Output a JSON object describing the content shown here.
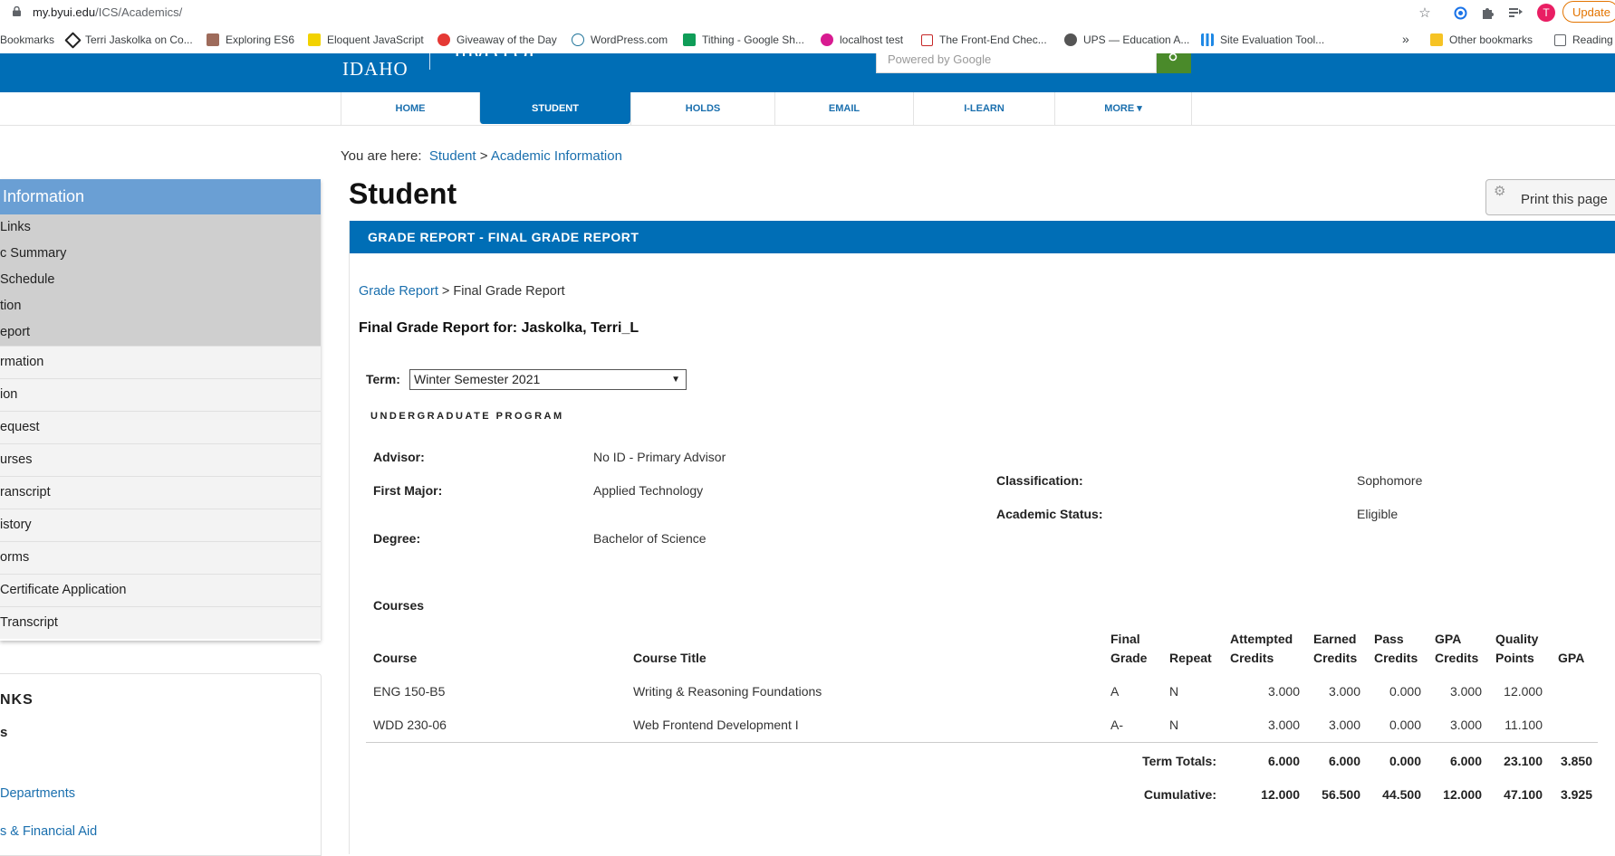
{
  "browser": {
    "url_host": "my.byui.edu",
    "url_path": "/ICS/Academics/",
    "profile_initial": "T",
    "update_label": "Update"
  },
  "bookmarks": {
    "items": [
      {
        "label": "Bookmarks",
        "icon": "none"
      },
      {
        "label": "Terri Jaskolka on Co...",
        "icon": "codepen-icon"
      },
      {
        "label": "Exploring ES6",
        "icon": "book-icon"
      },
      {
        "label": "Eloquent JavaScript",
        "icon": "ejs-icon"
      },
      {
        "label": "Giveaway of the Day",
        "icon": "gift-icon"
      },
      {
        "label": "WordPress.com",
        "icon": "wordpress-icon"
      },
      {
        "label": "Tithing - Google Sh...",
        "icon": "sheets-icon"
      },
      {
        "label": "localhost test",
        "icon": "localhost-icon"
      },
      {
        "label": "The Front-End Chec...",
        "icon": "checklist-icon"
      },
      {
        "label": "UPS — Education A...",
        "icon": "globe-icon"
      },
      {
        "label": "Site Evaluation Tool...",
        "icon": "chart-icon"
      }
    ],
    "overflow": "»",
    "other": "Other bookmarks",
    "reading": "Reading"
  },
  "header": {
    "idaho": "IDAHO",
    "brand": "myBYUI",
    "search_placeholder": "Powered by Google"
  },
  "nav": {
    "items": [
      "HOME",
      "STUDENT",
      "HOLDS",
      "EMAIL",
      "I-LEARN",
      "MORE ▾"
    ],
    "active": "STUDENT"
  },
  "breadcrumb": {
    "prefix": "You are here:",
    "crumb1": "Student",
    "sep": ">",
    "crumb2": "Academic Information"
  },
  "sidebar": {
    "heading": "Information",
    "sub_items": [
      "Links",
      "c Summary",
      "Schedule",
      "tion",
      "eport"
    ],
    "items": [
      "rmation",
      "ion",
      "equest",
      "urses",
      "ranscript",
      "istory",
      "orms",
      "Certificate Application",
      "Transcript"
    ]
  },
  "links_box": {
    "title": "NKS",
    "s": "s",
    "links": [
      "Departments",
      "s & Financial Aid"
    ]
  },
  "main": {
    "title": "Student",
    "print_label": "Print this page",
    "panel_title": "GRADE REPORT - FINAL GRADE REPORT",
    "sub_crumb_link": "Grade Report",
    "sub_crumb_sep": ">",
    "sub_crumb_current": "Final Grade Report",
    "report_for": "Final Grade Report for: Jaskolka, Terri_L",
    "term_label": "Term:",
    "term_value": "Winter Semester 2021",
    "program": "UNDERGRADUATE PROGRAM",
    "info": {
      "advisor_label": "Advisor:",
      "advisor": "No ID - Primary Advisor",
      "major_label": "First Major:",
      "major": "Applied Technology",
      "degree_label": "Degree:",
      "degree": "Bachelor of Science",
      "class_label": "Classification:",
      "classification": "Sophomore",
      "status_label": "Academic Status:",
      "status": "Eligible"
    },
    "courses_label": "Courses"
  },
  "table": {
    "headers": {
      "course": "Course",
      "title": "Course Title",
      "final_grade_1": "Final",
      "final_grade_2": "Grade",
      "repeat": "Repeat",
      "attempted_1": "Attempted",
      "attempted_2": "Credits",
      "earned_1": "Earned",
      "earned_2": "Credits",
      "pass_1": "Pass",
      "pass_2": "Credits",
      "gpa_credits_1": "GPA",
      "gpa_credits_2": "Credits",
      "quality_1": "Quality",
      "quality_2": "Points",
      "gpa": "GPA"
    },
    "rows": [
      {
        "course": "ENG 150-B5",
        "title": "Writing & Reasoning Foundations",
        "grade": "A",
        "repeat": "N",
        "attempted": "3.000",
        "earned": "3.000",
        "pass": "0.000",
        "gpa_credits": "3.000",
        "quality": "12.000"
      },
      {
        "course": "WDD 230-06",
        "title": "Web Frontend Development I",
        "grade": "A-",
        "repeat": "N",
        "attempted": "3.000",
        "earned": "3.000",
        "pass": "0.000",
        "gpa_credits": "3.000",
        "quality": "11.100"
      }
    ],
    "term_totals": {
      "label": "Term Totals:",
      "attempted": "6.000",
      "earned": "6.000",
      "pass": "0.000",
      "gpa_credits": "6.000",
      "quality": "23.100",
      "gpa": "3.850"
    },
    "cumulative": {
      "label": "Cumulative:",
      "attempted": "12.000",
      "earned": "56.500",
      "pass": "44.500",
      "gpa_credits": "12.000",
      "quality": "47.100",
      "gpa": "3.925"
    }
  }
}
